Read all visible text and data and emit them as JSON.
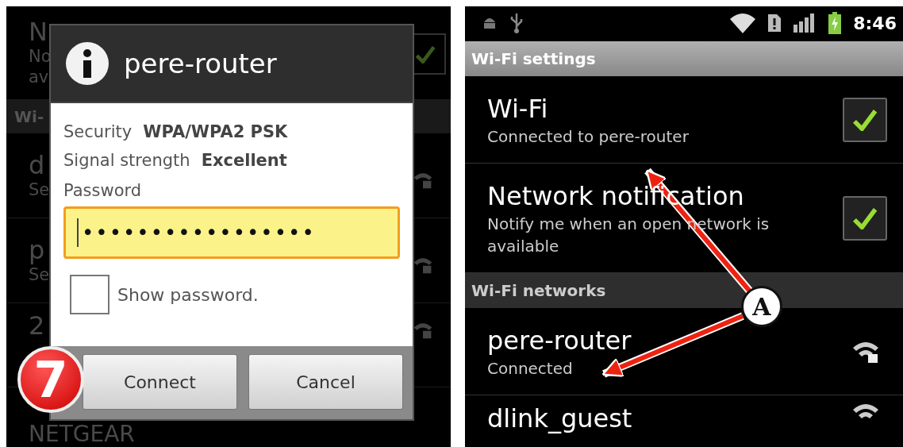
{
  "left_screen": {
    "background_rows": [
      {
        "title": "N",
        "subtitle_lines": [
          "No",
          "av"
        ],
        "checked": true,
        "secured": false
      },
      {
        "kind": "header",
        "title": "Wi-"
      },
      {
        "title": "d",
        "subtitle_lines": [
          "Se"
        ],
        "secured": true
      },
      {
        "title": "p",
        "subtitle_lines": [
          "Se"
        ],
        "secured": true
      },
      {
        "title": "2",
        "subtitle_lines": [],
        "secured": true
      },
      {
        "title": "NETGEAR",
        "subtitle_lines": [],
        "secured": false
      }
    ],
    "dialog": {
      "title": "pere-router",
      "details": [
        {
          "label": "Security",
          "value": "WPA/WPA2 PSK"
        },
        {
          "label": "Signal strength",
          "value": "Excellent"
        }
      ],
      "password": {
        "label": "Password",
        "value": "•••••••••••••••••",
        "focused": true
      },
      "show_password": {
        "label": "Show password.",
        "checked": false
      },
      "buttons": [
        "Connect",
        "Cancel"
      ]
    },
    "step_marker": "7"
  },
  "right_screen": {
    "status_bar": {
      "time": "8:46"
    },
    "sections": [
      {
        "header": "Wi-Fi settings",
        "items": [
          {
            "kind": "toggle",
            "title": "Wi-Fi",
            "subtitle": "Connected to pere-router",
            "checked": true
          },
          {
            "kind": "toggle",
            "title": "Network notification",
            "subtitle": "Notify me when an open network is available",
            "checked": true
          }
        ]
      },
      {
        "header": "Wi-Fi networks",
        "items": [
          {
            "kind": "network",
            "title": "pere-router",
            "subtitle": "Connected",
            "secured": true
          },
          {
            "kind": "network",
            "title": "dlink_guest",
            "secured": false
          }
        ]
      }
    ]
  },
  "annotation": {
    "label": "A"
  }
}
